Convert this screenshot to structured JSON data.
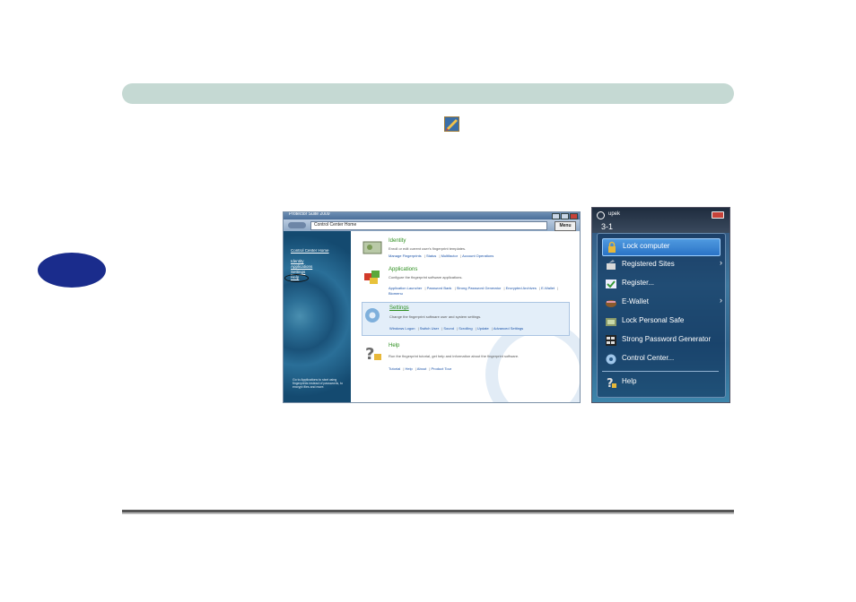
{
  "control_center": {
    "window_title": "Protector Suite 2009",
    "address": "Control Center Home",
    "menu_label": "Menu",
    "sidebar": {
      "links": [
        "Control Center Home",
        "Identity",
        "Applications",
        "Settings",
        "Help"
      ],
      "note": "Go to Applications to start using fingerprints instead of passwords, to encrypt files and more."
    },
    "sections": [
      {
        "title": "Identity",
        "desc": "Enroll or edit current user's fingerprint templates.",
        "links": [
          "Manage Fingerprints",
          "Status",
          "Multifactor",
          "Account Operations"
        ]
      },
      {
        "title": "Applications",
        "desc": "Configure the fingerprint software applications.",
        "links": [
          "Application Launcher",
          "Password Bank",
          "Strong Password Generator",
          "Encrypted Archives",
          "E-Wallet",
          "Biomenu"
        ]
      },
      {
        "title": "Settings",
        "desc": "Change the fingerprint software user and system settings.",
        "links": [
          "Windows Logon",
          "Switch User",
          "Sound",
          "Scrolling",
          "Update",
          "Advanced Settings"
        ]
      },
      {
        "title": "Help",
        "desc": "Run the fingerprint tutorial, get help and information about the fingerprint software.",
        "links": [
          "Tutorial",
          "Help",
          "About",
          "Product Tour"
        ]
      }
    ]
  },
  "tray_menu": {
    "brand": "upek",
    "user": "3-1",
    "items": [
      {
        "label": "Lock computer",
        "icon": "lock-icon"
      },
      {
        "label": "Registered Sites",
        "icon": "sites-icon"
      },
      {
        "label": "Register...",
        "icon": "register-icon"
      },
      {
        "label": "E-Wallet",
        "icon": "wallet-icon"
      },
      {
        "label": "Lock Personal Safe",
        "icon": "safe-icon"
      },
      {
        "label": "Strong Password Generator",
        "icon": "password-generator-icon"
      },
      {
        "label": "Control Center...",
        "icon": "gear-icon"
      },
      {
        "label": "Help",
        "icon": "help-icon"
      }
    ]
  }
}
